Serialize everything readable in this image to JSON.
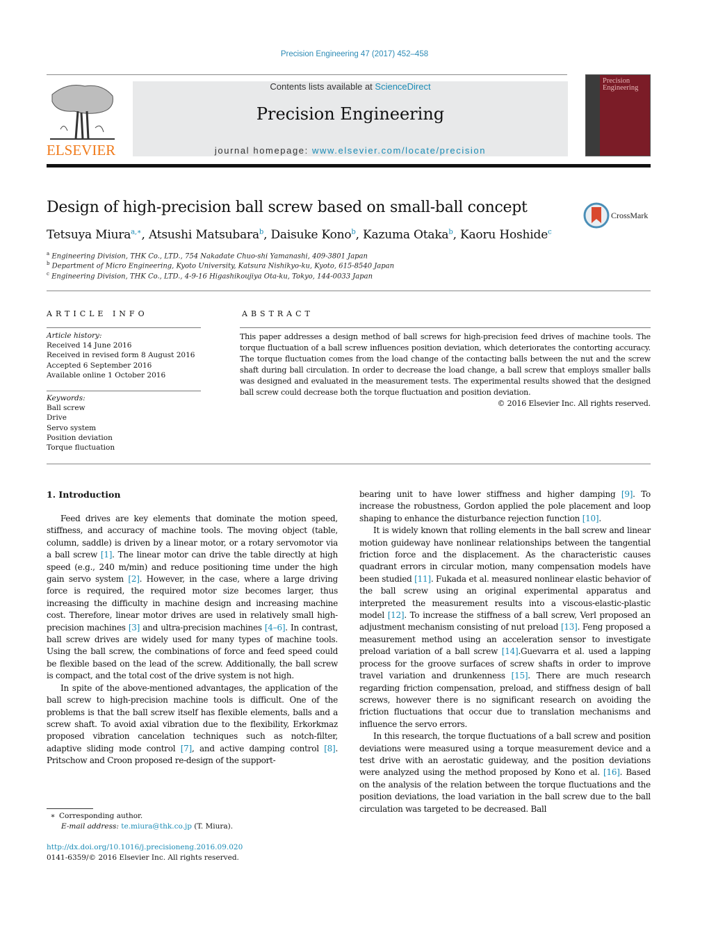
{
  "header": {
    "journal_ref": "Precision Engineering 47 (2017) 452–458",
    "contents_prefix": "Contents lists available at ",
    "contents_link": "ScienceDirect",
    "journal_title": "Precision Engineering",
    "homepage_prefix": "journal homepage: ",
    "homepage_link": "www.elsevier.com/locate/precision",
    "publisher_logo": "ELSEVIER",
    "cover_title_line1": "Precision",
    "cover_title_line2": "Engineering",
    "crossmark_label": "CrossMark"
  },
  "article": {
    "title": "Design of high-precision ball screw based on small-ball concept",
    "authors": [
      {
        "name": "Tetsuya Miura",
        "sup": "a,∗"
      },
      {
        "name": "Atsushi Matsubara",
        "sup": "b"
      },
      {
        "name": "Daisuke Kono",
        "sup": "b"
      },
      {
        "name": "Kazuma Otaka",
        "sup": "b"
      },
      {
        "name": "Kaoru Hoshide",
        "sup": "c"
      }
    ],
    "affiliations": [
      {
        "mark": "a",
        "text": "Engineering Division, THK Co., LTD., 754 Nakadate Chuo-shi Yamanashi, 409-3801 Japan"
      },
      {
        "mark": "b",
        "text": "Department of Micro Engineering, Kyoto University, Katsura Nishikyo-ku, Kyoto, 615-8540 Japan"
      },
      {
        "mark": "c",
        "text": "Engineering Division, THK Co., LTD., 4-9-16 Higashikoujiya Ota-ku, Tokyo, 144-0033 Japan"
      }
    ]
  },
  "article_info": {
    "heading": "ARTICLE INFO",
    "history_label": "Article history:",
    "history": [
      "Received 14 June 2016",
      "Received in revised form 8 August 2016",
      "Accepted 6 September 2016",
      "Available online 1 October 2016"
    ],
    "keywords_label": "Keywords:",
    "keywords": [
      "Ball screw",
      "Drive",
      "Servo system",
      "Position deviation",
      "Torque fluctuation"
    ]
  },
  "abstract": {
    "heading": "ABSTRACT",
    "text": "This paper addresses a design method of ball screws for high-precision feed drives of machine tools. The torque fluctuation of a ball screw influences position deviation, which deteriorates the contorting accuracy. The torque fluctuation comes from the load change of the contacting balls between the nut and the screw shaft during ball circulation. In order to decrease the load change, a ball screw that employs smaller balls was designed and evaluated in the measurement tests. The experimental results showed that the designed ball screw could decrease both the torque fluctuation and position deviation.",
    "copyright": "© 2016 Elsevier Inc. All rights reserved."
  },
  "body": {
    "section_heading": "1.  Introduction",
    "left_paragraphs": [
      [
        {
          "t": "Feed drives are key elements that dominate the motion speed, stiffness, and accuracy of machine tools. The moving object (table, column, saddle) is driven by a linear motor, or a rotary servomotor via a ball screw "
        },
        {
          "c": "[1]"
        },
        {
          "t": ". The linear motor can drive the table directly at high speed (e.g., 240 m/min) and reduce positioning time under the high gain servo system "
        },
        {
          "c": "[2]"
        },
        {
          "t": ". However, in the case, where a large driving force is required, the required motor size becomes larger, thus increasing the difficulty in machine design and increasing machine cost. Therefore, linear motor drives are used in relatively small high-precision machines "
        },
        {
          "c": "[3]"
        },
        {
          "t": " and ultra-precision machines "
        },
        {
          "c": "[4–6]"
        },
        {
          "t": ". In contrast, ball screw drives are widely used for many types of machine tools. Using the ball screw, the combinations of force and feed speed could be flexible based on the lead of the screw. Additionally, the ball screw is compact, and the total cost of the drive system is not high."
        }
      ],
      [
        {
          "t": "In spite of the above-mentioned advantages, the application of the ball screw to high-precision machine tools is difficult. One of the problems is that the ball screw itself has flexible elements, balls and a screw shaft. To avoid axial vibration due to the flexibility, Erkorkmaz proposed vibration cancelation techniques such as notch-filter, adaptive sliding mode control "
        },
        {
          "c": "[7]"
        },
        {
          "t": ", and active damping control "
        },
        {
          "c": "[8]"
        },
        {
          "t": ". Pritschow and Croon proposed re-design of the support-"
        }
      ]
    ],
    "right_paragraphs": [
      [
        {
          "t": "bearing unit to have lower stiffness and higher damping "
        },
        {
          "c": "[9]"
        },
        {
          "t": ". To increase the robustness, Gordon applied the pole placement and loop shaping to enhance the disturbance rejection function "
        },
        {
          "c": "[10]"
        },
        {
          "t": "."
        }
      ],
      [
        {
          "t": "It is widely known that rolling elements in the ball screw and linear motion guideway have nonlinear relationships between the tangential friction force and the displacement. As the characteristic causes quadrant errors in circular motion, many compensation models have been studied "
        },
        {
          "c": "[11]"
        },
        {
          "t": ". Fukada et al. measured nonlinear elastic behavior of the ball screw using an original experimental apparatus and interpreted the measurement results into a viscous-elastic-plastic model "
        },
        {
          "c": "[12]"
        },
        {
          "t": ". To increase the stiffness of a ball screw, Verl proposed an adjustment mechanism consisting of nut preload "
        },
        {
          "c": "[13]"
        },
        {
          "t": ". Feng proposed a measurement method using an acceleration sensor to investigate preload variation of a ball screw "
        },
        {
          "c": "[14]"
        },
        {
          "t": ".Guevarra et al. used a lapping process for the groove surfaces of screw shafts in order to improve travel variation and drunkenness "
        },
        {
          "c": "[15]"
        },
        {
          "t": ". There are much research regarding friction compensation, preload, and stiffness design of ball screws, however there is no significant research on avoiding the friction fluctuations that occur due to translation mechanisms and influence the servo errors."
        }
      ],
      [
        {
          "t": "In this research, the torque fluctuations of a ball screw and position deviations were measured using a torque measurement device and a test drive with an aerostatic guideway, and the position deviations were analyzed using the method proposed by Kono et al. "
        },
        {
          "c": "[16]"
        },
        {
          "t": ". Based on the analysis of the relation between the torque fluctuations and the position deviations, the load variation in the ball screw due to the ball circulation was targeted to be decreased. Ball"
        }
      ]
    ]
  },
  "footnote": {
    "mark": "∗",
    "corresponding": "Corresponding author.",
    "email_label": "E-mail address:",
    "email": "te.miura@thk.co.jp",
    "email_suffix": " (T. Miura)."
  },
  "doi": {
    "url": "http://dx.doi.org/10.1016/j.precisioneng.2016.09.020",
    "issn_line": "0141-6359/© 2016 Elsevier Inc. All rights reserved."
  }
}
